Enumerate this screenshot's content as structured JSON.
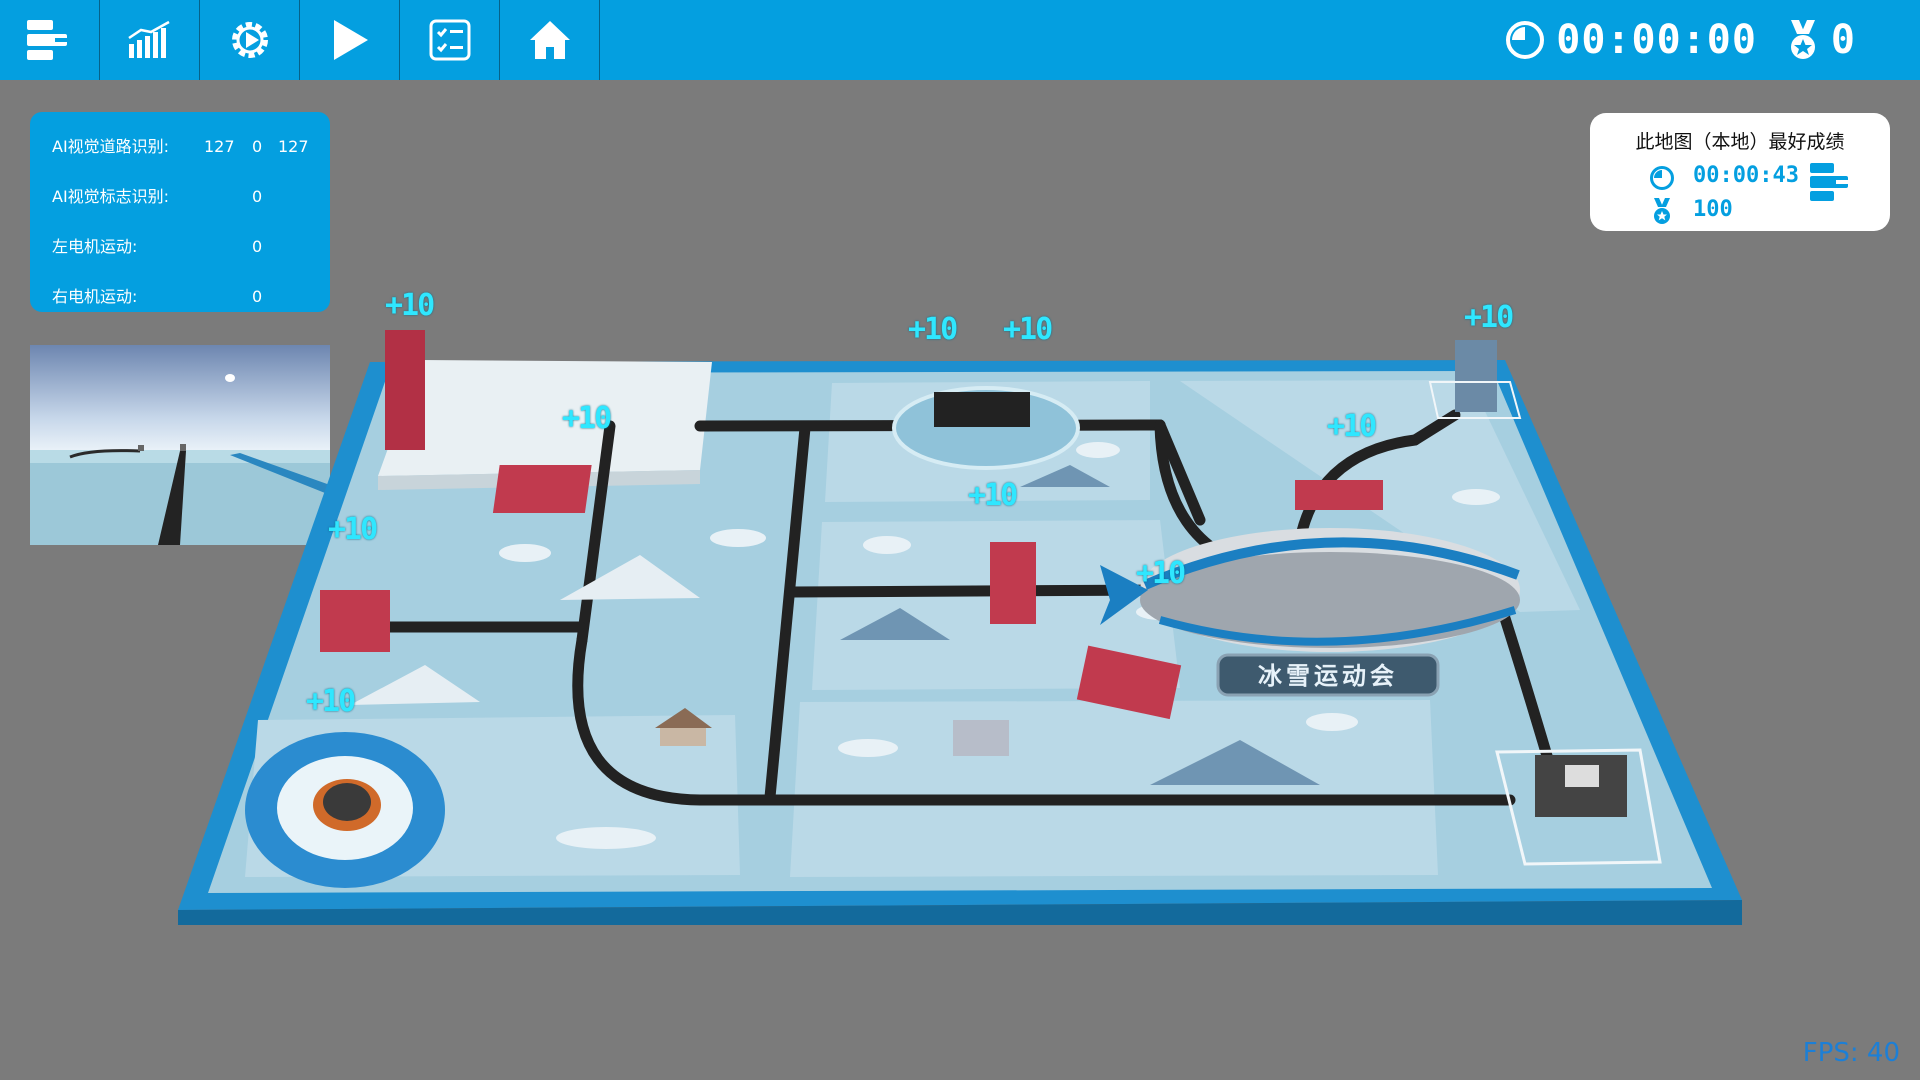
{
  "toolbar": {
    "buttons": [
      {
        "name": "blocks-icon"
      },
      {
        "name": "chart-icon"
      },
      {
        "name": "gear-play-icon"
      },
      {
        "name": "play-icon"
      },
      {
        "name": "checklist-icon"
      },
      {
        "name": "home-icon"
      }
    ],
    "timer": "00:00:00",
    "score": "0"
  },
  "sensors": [
    {
      "label": "AI视觉道路识别:",
      "v1": "127",
      "v2": "0",
      "v3": "127"
    },
    {
      "label": "AI视觉标志识别:",
      "v1": "",
      "v2": "0",
      "v3": ""
    },
    {
      "label": "左电机运动:",
      "v1": "",
      "v2": "0",
      "v3": ""
    },
    {
      "label": "右电机运动:",
      "v1": "",
      "v2": "0",
      "v3": ""
    }
  ],
  "best": {
    "title": "此地图（本地）最好成绩",
    "time": "00:00:43",
    "score": "100"
  },
  "board": {
    "sign_text": "冰雪运动会",
    "bonus_label": "+10"
  },
  "fps": "FPS: 40",
  "colors": {
    "toolbar": "#049fe0",
    "background": "#7b7b7b",
    "bonus": "#2fe7ff",
    "board_frame": "#1e8fcf",
    "board_mat": "#a6cfe0"
  }
}
